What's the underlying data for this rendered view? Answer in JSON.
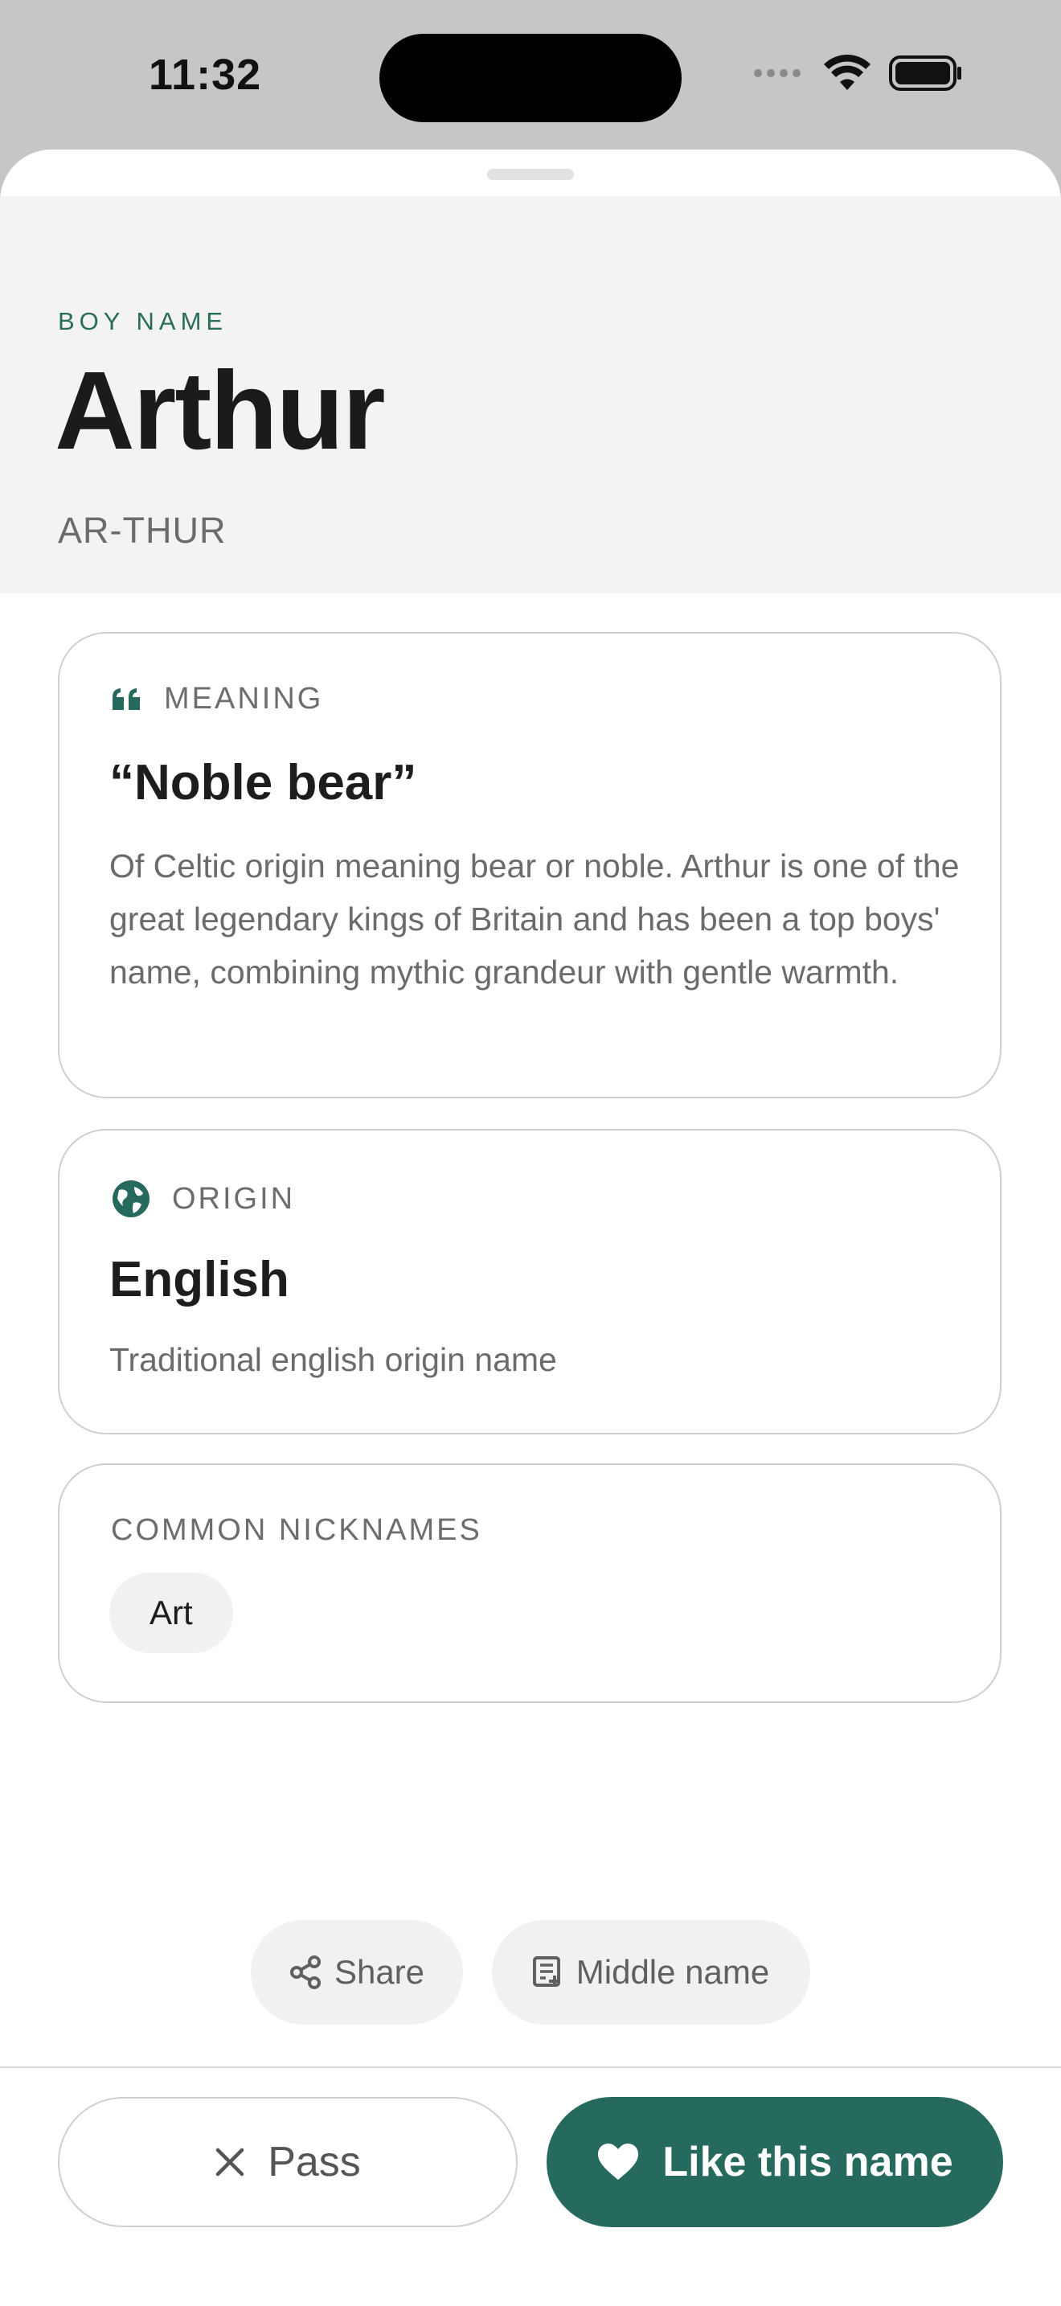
{
  "status_bar": {
    "time": "11:32"
  },
  "header": {
    "kicker": "BOY NAME",
    "title": "Arthur",
    "pronunciation": "AR-THUR"
  },
  "meaning": {
    "label": "MEANING",
    "icon": "quote-icon",
    "heading": "“Noble bear”",
    "body": "Of Celtic origin meaning bear or noble. Arthur is one of the great legendary kings of Britain and has been a top boys' name, combining mythic grandeur with gentle warmth."
  },
  "origin": {
    "label": "ORIGIN",
    "icon": "globe-icon",
    "heading": "English",
    "body": "Traditional english origin name"
  },
  "nicknames": {
    "label": "COMMON NICKNAMES",
    "items": [
      "Art"
    ]
  },
  "actions": {
    "share_label": "Share",
    "middle_name_label": "Middle name"
  },
  "buttons": {
    "pass_label": "Pass",
    "like_label": "Like this name"
  },
  "colors": {
    "accent": "#256a5c",
    "header_bg": "#f3f3f1",
    "chip_bg": "#f1f1ef"
  }
}
